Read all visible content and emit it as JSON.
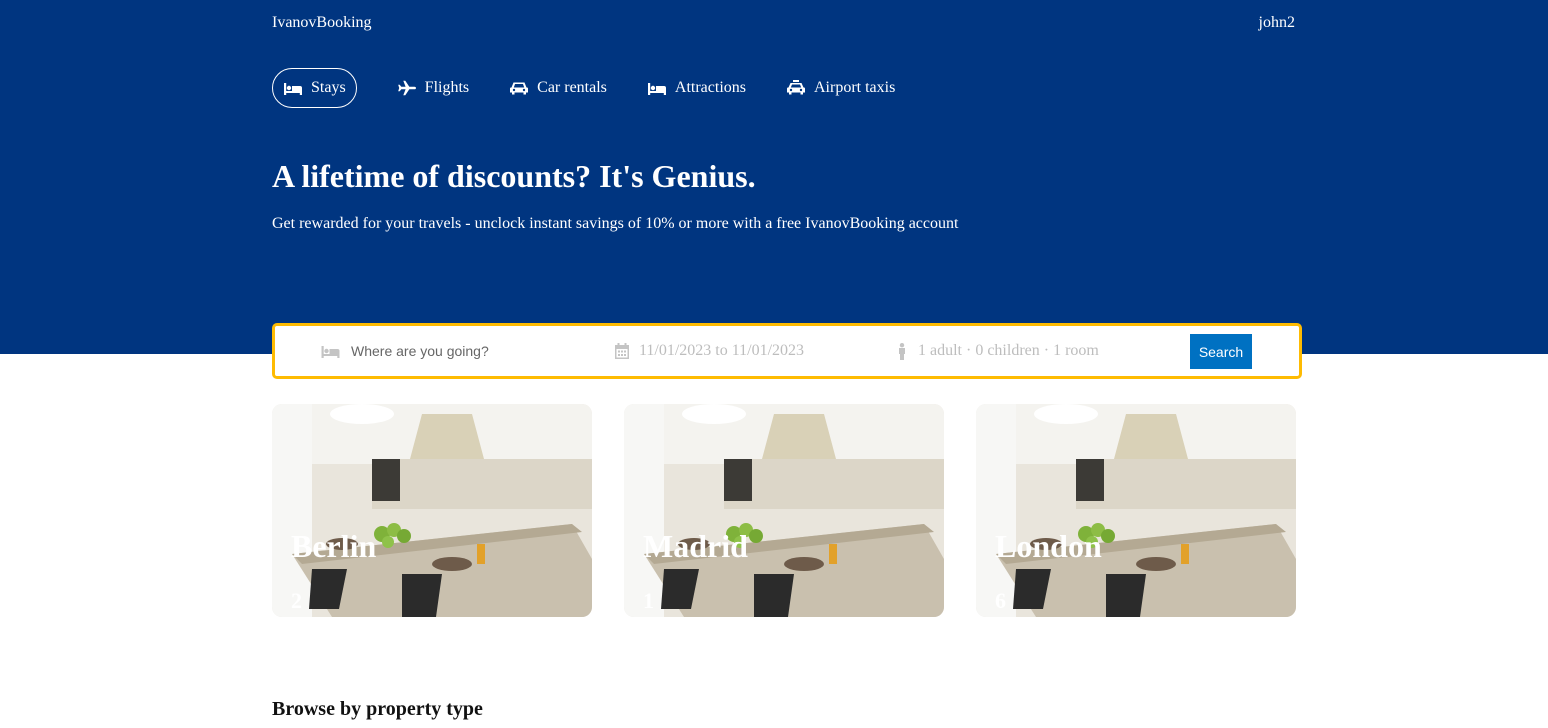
{
  "header": {
    "brand": "IvanovBooking",
    "user": "john2"
  },
  "nav": {
    "items": [
      {
        "label": "Stays",
        "icon": "bed-icon",
        "active": true
      },
      {
        "label": "Flights",
        "icon": "plane-icon"
      },
      {
        "label": "Car rentals",
        "icon": "car-icon"
      },
      {
        "label": "Attractions",
        "icon": "bed-icon"
      },
      {
        "label": "Airport taxis",
        "icon": "taxi-icon"
      }
    ]
  },
  "hero": {
    "title": "A lifetime of discounts? It's Genius.",
    "description": "Get rewarded for your travels - unclock instant savings of 10% or more with a free IvanovBooking account"
  },
  "search": {
    "destination_placeholder": "Where are you going?",
    "date_range": "11/01/2023 to 11/01/2023",
    "options": "1 adult · 0 children · 1 room",
    "button_label": "Search"
  },
  "featured": [
    {
      "city": "Berlin",
      "count": "2"
    },
    {
      "city": "Madrid",
      "count": "1"
    },
    {
      "city": "London",
      "count": "6"
    }
  ],
  "sections": {
    "browse_title": "Browse by property type"
  },
  "colors": {
    "hero_bg": "#003580",
    "search_border": "#febb02",
    "button": "#0071c2"
  }
}
